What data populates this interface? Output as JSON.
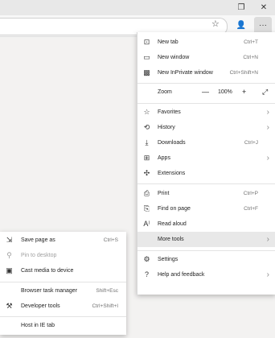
{
  "titlebar": {
    "restore_icon": "restore-icon",
    "close_icon": "close-icon"
  },
  "toolbar": {
    "favorite_icon": "star-icon",
    "profile_icon": "person-icon",
    "menu_icon": "ellipsis-icon"
  },
  "menu": {
    "new_tab": {
      "label": "New tab",
      "shortcut": "Ctrl+T"
    },
    "new_window": {
      "label": "New window",
      "shortcut": "Ctrl+N"
    },
    "new_inprivate": {
      "label": "New InPrivate window",
      "shortcut": "Ctrl+Shift+N"
    },
    "zoom": {
      "label": "Zoom",
      "minus": "—",
      "value": "100%",
      "plus": "+"
    },
    "favorites": {
      "label": "Favorites"
    },
    "history": {
      "label": "History"
    },
    "downloads": {
      "label": "Downloads",
      "shortcut": "Ctrl+J"
    },
    "apps": {
      "label": "Apps"
    },
    "extensions": {
      "label": "Extensions"
    },
    "print": {
      "label": "Print",
      "shortcut": "Ctrl+P"
    },
    "find_on_page": {
      "label": "Find on page",
      "shortcut": "Ctrl+F"
    },
    "read_aloud": {
      "label": "Read aloud"
    },
    "more_tools": {
      "label": "More tools"
    },
    "settings": {
      "label": "Settings"
    },
    "help": {
      "label": "Help and feedback"
    }
  },
  "submenu": {
    "save_page": {
      "label": "Save page as",
      "shortcut": "Ctrl+S"
    },
    "pin": {
      "label": "Pin to desktop"
    },
    "cast": {
      "label": "Cast media to device"
    },
    "task_manager": {
      "label": "Browser task manager",
      "shortcut": "Shift+Esc"
    },
    "dev_tools": {
      "label": "Developer tools",
      "shortcut": "Ctrl+Shift+I"
    },
    "ie_tab": {
      "label": "Host in IE tab"
    }
  }
}
